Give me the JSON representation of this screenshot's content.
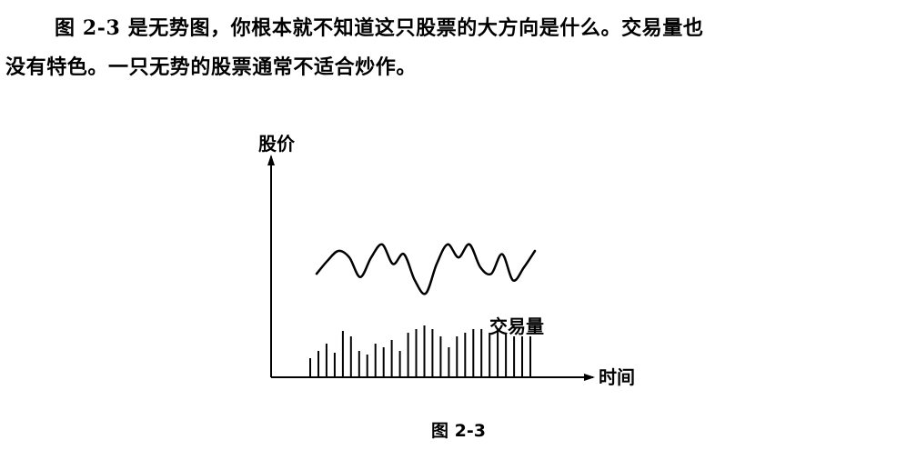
{
  "paragraph": {
    "line1": "图 2-3 是无势图，你根本就不知道这只股票的大方向是什么。交易量也",
    "line2": "没有特色。一只无势的股票通常不适合炒作。"
  },
  "figure": {
    "caption": "图 2-3"
  },
  "chart_data": {
    "type": "line",
    "title": "",
    "ylabel": "股价",
    "xlabel": "时间",
    "annotations": [
      "交易量"
    ],
    "grid": false,
    "axis_ticks": false,
    "series": [
      {
        "name": "",
        "kind": "price-line",
        "x": [
          0,
          1,
          2,
          3,
          4,
          5,
          6,
          7,
          8,
          9,
          10,
          11,
          12,
          13,
          14,
          15,
          16,
          17,
          18,
          19,
          20
        ],
        "values": [
          2,
          4,
          5.5,
          4.5,
          1.5,
          4.5,
          6.5,
          3.5,
          5,
          1,
          -1,
          3.5,
          6.5,
          4.5,
          6.5,
          3,
          2,
          5,
          1,
          3,
          5.5
        ],
        "ylim": [
          -2,
          8
        ]
      },
      {
        "name": "交易量",
        "kind": "volume-bars",
        "values": [
          10,
          14,
          18,
          13,
          25,
          22,
          14,
          12,
          18,
          16,
          20,
          14,
          24,
          26,
          28,
          26,
          22,
          16,
          22,
          24,
          26,
          26,
          24,
          26,
          24,
          22,
          22,
          22
        ],
        "ylim": [
          0,
          40
        ]
      }
    ]
  }
}
